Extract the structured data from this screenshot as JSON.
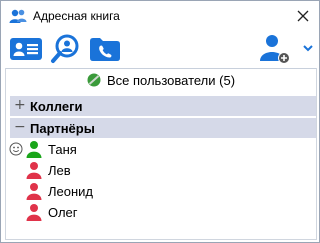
{
  "window": {
    "title": "Адресная книга",
    "close_label": "×"
  },
  "toolbar": {
    "contacts_icon": "contacts-card-icon",
    "search_icon": "search-person-icon",
    "calls_icon": "calls-folder-icon",
    "add_user_icon": "add-user-icon",
    "dropdown_icon": "chevron-down-icon"
  },
  "list": {
    "all_users_label": "Все пользователи (5)",
    "groups": [
      {
        "sign": "+",
        "label": "Коллеги"
      },
      {
        "sign": "−",
        "label": "Партнёры"
      }
    ],
    "contacts": [
      {
        "name": "Таня",
        "status": "online",
        "color": "#1aa51a"
      },
      {
        "name": "Лев",
        "status": "offline",
        "color": "#e0334a"
      },
      {
        "name": "Леонид",
        "status": "offline",
        "color": "#e0334a"
      },
      {
        "name": "Олег",
        "status": "offline",
        "color": "#e0334a"
      }
    ]
  },
  "colors": {
    "accent_blue": "#1a73d9",
    "group_bg": "#d5d9e8",
    "online_green": "#1aa51a",
    "offline_red": "#e0334a"
  }
}
